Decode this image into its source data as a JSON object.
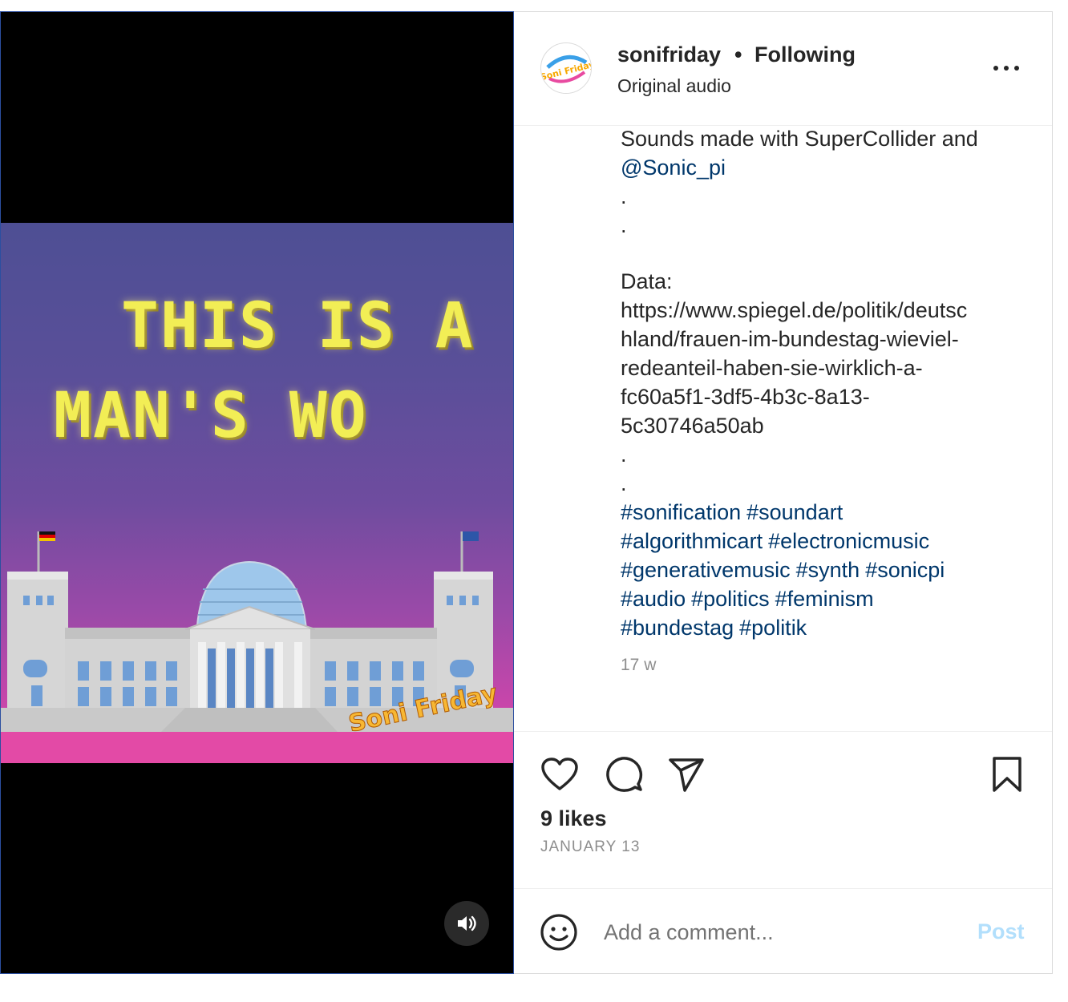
{
  "post": {
    "username": "sonifriday",
    "separator": "•",
    "follow_status": "Following",
    "audio": "Original audio",
    "avatar_text": "Soni Friday"
  },
  "media": {
    "title_line_1": "THIS IS A",
    "title_line_2": "MAN'S WO",
    "watermark": "Soni Friday",
    "sound_icon": "speaker-icon"
  },
  "caption": {
    "line1": "Sounds made with SuperCollider and",
    "mention": "@Sonic_pi",
    "dot": ".",
    "data_label": "Data:",
    "url_lines": [
      "https://www.spiegel.de/politik/deutsc",
      "hland/frauen-im-bundestag-wieviel-",
      "redeanteil-haben-sie-wirklich-a-",
      "fc60a5f1-3df5-4b3c-8a13-",
      "5c30746a50ab"
    ],
    "hashtags": [
      "#sonification",
      "#soundart",
      "#algorithmicart",
      "#electronicmusic",
      "#generativemusic",
      "#synth",
      "#sonicpi",
      "#audio",
      "#politics",
      "#feminism",
      "#bundestag",
      "#politik"
    ]
  },
  "timestamp": "17 w",
  "likes": "9 likes",
  "date": "JANUARY 13",
  "comment": {
    "placeholder": "Add a comment...",
    "post_label": "Post"
  },
  "colors": {
    "link": "#00376b",
    "post_button": "#b2dffc",
    "muted": "#8e8e8e"
  }
}
